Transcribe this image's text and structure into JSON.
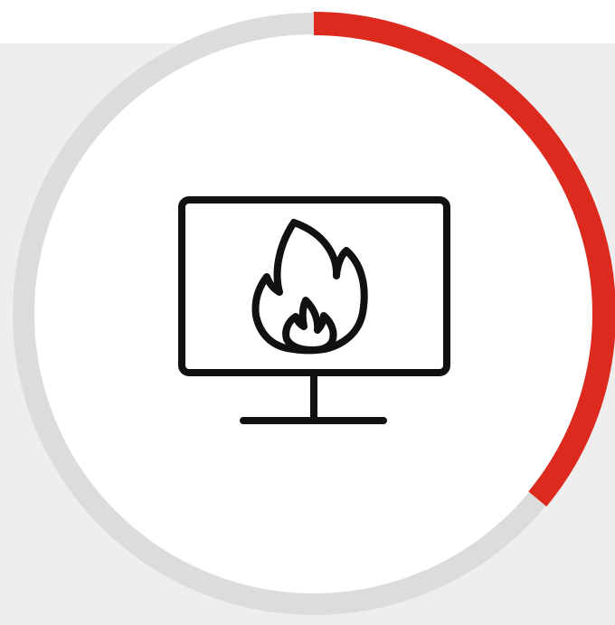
{
  "progress": {
    "fraction": 0.36,
    "track_color": "#dcdcdc",
    "fill_color": "#dc2a1e",
    "center_color": "#ffffff"
  },
  "background": {
    "page_color": "#ffffff",
    "panel_color": "#efeeef"
  },
  "icon": {
    "name": "monitor-with-flame-icon",
    "stroke_color": "#111111"
  }
}
